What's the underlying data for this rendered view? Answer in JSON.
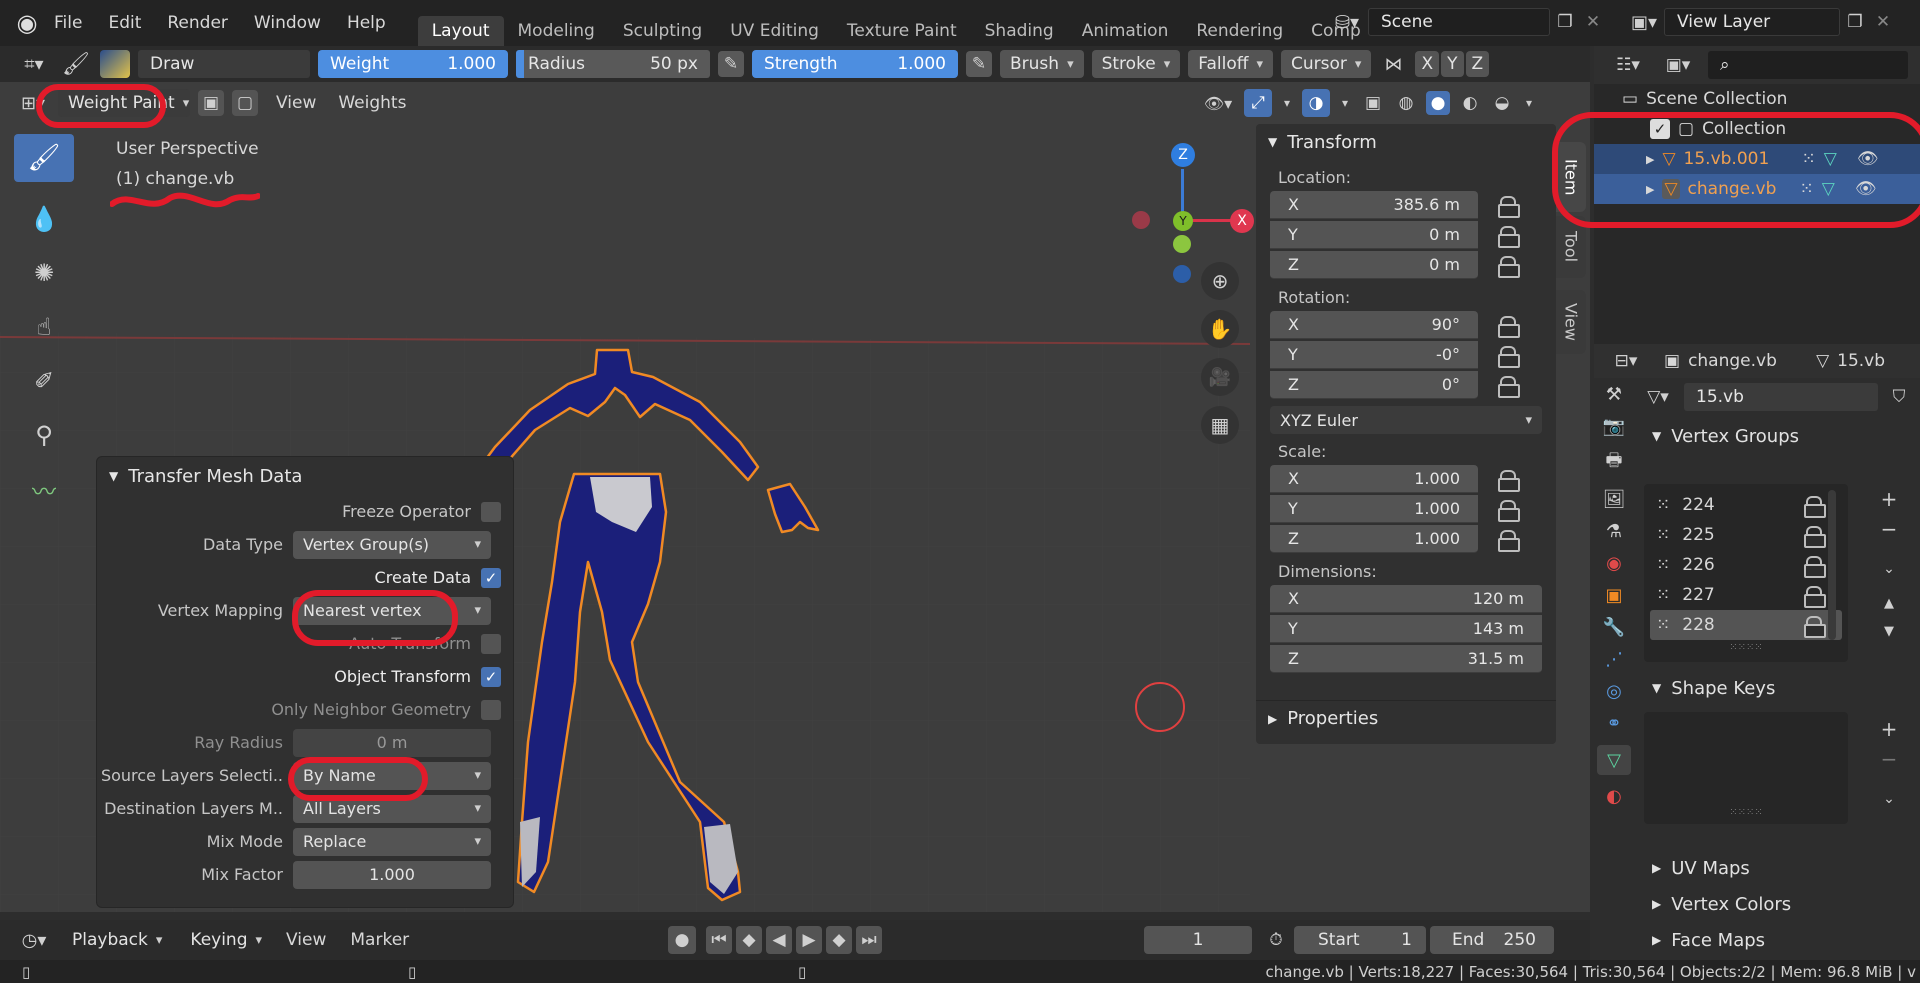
{
  "menu": [
    "File",
    "Edit",
    "Render",
    "Window",
    "Help"
  ],
  "workspaces": [
    "Layout",
    "Modeling",
    "Sculpting",
    "UV Editing",
    "Texture Paint",
    "Shading",
    "Animation",
    "Rendering",
    "Comp"
  ],
  "scene": "Scene",
  "view_layer": "View Layer",
  "toolbar": {
    "brush_name": "Draw",
    "weight_label": "Weight",
    "weight_value": "1.000",
    "radius_label": "Radius",
    "radius_value": "50 px",
    "strength_label": "Strength",
    "strength_value": "1.000",
    "menus": [
      "Brush",
      "Stroke",
      "Falloff",
      "Cursor"
    ],
    "axes": [
      "X",
      "Y",
      "Z"
    ]
  },
  "header2": {
    "mode": "Weight Paint",
    "menus": [
      "View",
      "Weights"
    ]
  },
  "viewport": {
    "perspective": "User Perspective",
    "object": "(1) change.vb",
    "gizmo": {
      "x": "X",
      "y": "Y",
      "z": "Z"
    }
  },
  "operator": {
    "title": "Transfer Mesh Data",
    "freeze": "Freeze Operator",
    "data_type_label": "Data Type",
    "data_type": "Vertex Group(s)",
    "create_data": "Create Data",
    "vertex_mapping_label": "Vertex Mapping",
    "vertex_mapping": "Nearest vertex",
    "auto_transform": "Auto Transform",
    "object_transform": "Object Transform",
    "only_neighbor": "Only Neighbor Geometry",
    "ray_radius_label": "Ray Radius",
    "ray_radius": "0 m",
    "source_layers_label": "Source Layers Selecti..",
    "source_layers": "By Name",
    "dest_layers_label": "Destination Layers M..",
    "dest_layers": "All Layers",
    "mix_mode_label": "Mix Mode",
    "mix_mode": "Replace",
    "mix_factor_label": "Mix Factor",
    "mix_factor": "1.000"
  },
  "npanel": {
    "title": "Transform",
    "location": "Location:",
    "loc": [
      {
        "a": "X",
        "v": "385.6 m"
      },
      {
        "a": "Y",
        "v": "0 m"
      },
      {
        "a": "Z",
        "v": "0 m"
      }
    ],
    "rotation": "Rotation:",
    "rot": [
      {
        "a": "X",
        "v": "90°"
      },
      {
        "a": "Y",
        "v": "-0°"
      },
      {
        "a": "Z",
        "v": "0°"
      }
    ],
    "rot_mode": "XYZ Euler",
    "scale": "Scale:",
    "scl": [
      {
        "a": "X",
        "v": "1.000"
      },
      {
        "a": "Y",
        "v": "1.000"
      },
      {
        "a": "Z",
        "v": "1.000"
      }
    ],
    "dimensions": "Dimensions:",
    "dim": [
      {
        "a": "X",
        "v": "120 m"
      },
      {
        "a": "Y",
        "v": "143 m"
      },
      {
        "a": "Z",
        "v": "31.5 m"
      }
    ],
    "properties": "Properties",
    "tabs": [
      "Item",
      "Tool",
      "View"
    ]
  },
  "outliner": {
    "scene_collection": "Scene Collection",
    "collection": "Collection",
    "objects": [
      "15.vb.001",
      "change.vb"
    ]
  },
  "properties": {
    "object": "change.vb",
    "mesh": "15.vb",
    "mesh_name": "15.vb",
    "vertex_groups": "Vertex Groups",
    "groups": [
      "224",
      "225",
      "226",
      "227",
      "228"
    ],
    "shape_keys": "Shape Keys",
    "uv_maps": "UV Maps",
    "vertex_colors": "Vertex Colors",
    "face_maps": "Face Maps"
  },
  "timeline": {
    "menus": [
      "Playback",
      "Keying",
      "View",
      "Marker"
    ],
    "frame": "1",
    "start_label": "Start",
    "start": "1",
    "end_label": "End",
    "end": "250"
  },
  "status": "change.vb | Verts:18,227 | Faces:30,564 | Tris:30,564 | Objects:2/2 | Mem: 96.8 MiB | v",
  "colors": {
    "accent": "#4d8ee0",
    "annotation": "#e21b2a",
    "mesh": "#1b1f7a",
    "outline": "#f08a24"
  }
}
